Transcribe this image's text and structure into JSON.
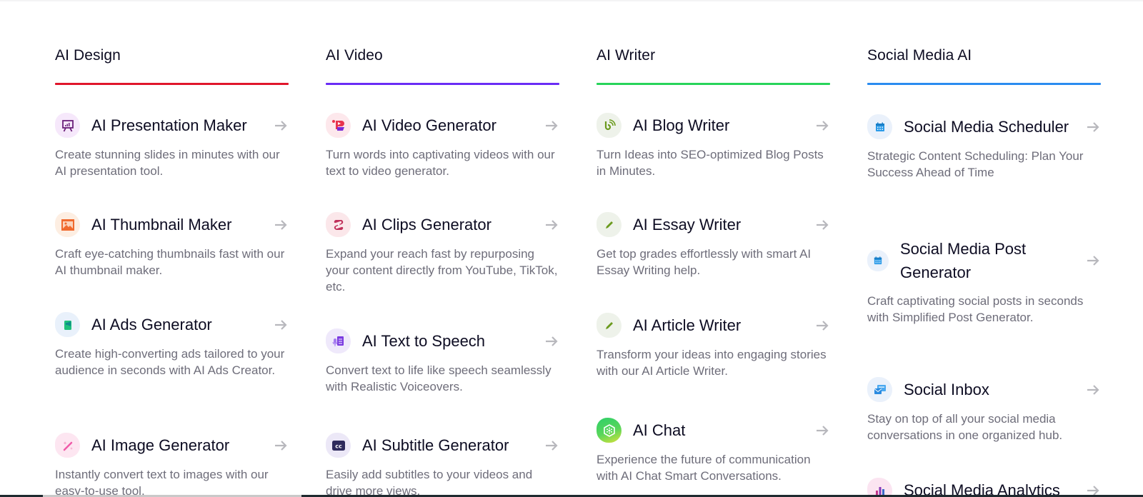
{
  "columns": [
    {
      "title": "AI Design",
      "accent": "#e0162b",
      "items": [
        {
          "title": "AI Presentation Maker",
          "desc": "Create stunning slides in minutes with our AI presentation tool.",
          "icon": "presentation-icon"
        },
        {
          "title": "AI Thumbnail Maker",
          "desc": "Craft eye-catching thumbnails fast with our AI thumbnail maker.",
          "icon": "image-film-icon"
        },
        {
          "title": "AI Ads Generator",
          "desc": "Create high-converting ads tailored to your audience in seconds with AI Ads Creator.",
          "icon": "ads-megaphone-icon"
        },
        {
          "title": "AI Image Generator",
          "desc": "Instantly convert text to images with our easy-to-use tool.",
          "icon": "magic-wand-icon"
        }
      ]
    },
    {
      "title": "AI Video",
      "accent": "#6a2cf5",
      "items": [
        {
          "title": "AI Video Generator",
          "desc": "Turn words into captivating videos with our text to video generator.",
          "icon": "video-play-icon"
        },
        {
          "title": "AI Clips Generator",
          "desc": "Expand your reach fast by repurposing your content directly from YouTube, TikTok, etc.",
          "icon": "clips-icon"
        },
        {
          "title": "AI Text to Speech",
          "desc": "Convert text to life like speech seamlessly with Realistic Voiceovers.",
          "icon": "mic-document-icon"
        },
        {
          "title": "AI Subtitle Generator",
          "desc": "Easily add subtitles to your videos and drive more views.",
          "icon": "closed-captions-icon"
        }
      ]
    },
    {
      "title": "AI Writer",
      "accent": "#27d45a",
      "items": [
        {
          "title": "AI Blog Writer",
          "desc": "Turn Ideas into SEO-optimized Blog Posts in Minutes.",
          "icon": "blog-feed-icon"
        },
        {
          "title": "AI Essay Writer",
          "desc": "Get top grades effortlessly with smart AI Essay Writing help.",
          "icon": "pencil-icon"
        },
        {
          "title": "AI Article Writer",
          "desc": "Transform your ideas into engaging stories with our AI Article Writer.",
          "icon": "pencil-icon"
        },
        {
          "title": "AI Chat",
          "desc": "Experience the future of communication with AI Chat Smart Conversations.",
          "icon": "ai-chat-icon"
        }
      ]
    },
    {
      "title": "Social Media AI",
      "accent": "#2a8cf0",
      "items": [
        {
          "title": "Social Media Scheduler",
          "desc": "Strategic Content Scheduling: Plan Your Success Ahead of Time",
          "icon": "calendar-icon"
        },
        {
          "title": "Social Media Post Generator",
          "desc": "Craft captivating social posts in seconds with Simplified Post Generator.",
          "icon": "calendar-icon"
        },
        {
          "title": "Social Inbox",
          "desc": "Stay on top of all your social media conversations in one organized hub.",
          "icon": "inbox-icon"
        },
        {
          "title": "Social Media Analytics",
          "desc": "",
          "icon": "bar-chart-icon"
        }
      ]
    }
  ],
  "arrow_icon": "arrow-right-icon"
}
